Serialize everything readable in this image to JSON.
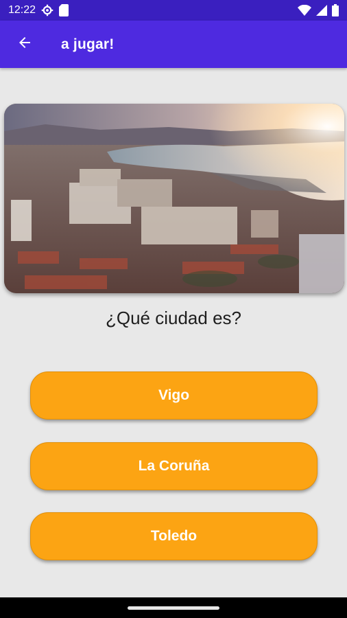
{
  "status_bar": {
    "time": "12:22",
    "icons": [
      "settings-icon",
      "sim-card-icon",
      "wifi-icon",
      "signal-icon",
      "battery-icon"
    ]
  },
  "app_bar": {
    "title": "a jugar!",
    "back_icon": "arrow-back-icon",
    "color": "#4e2ae0"
  },
  "quiz": {
    "image_description": "city-photo",
    "question": "¿Qué ciudad es?",
    "answers": [
      "Vigo",
      "La Coruña",
      "Toledo"
    ],
    "answer_color": "#fca413"
  }
}
